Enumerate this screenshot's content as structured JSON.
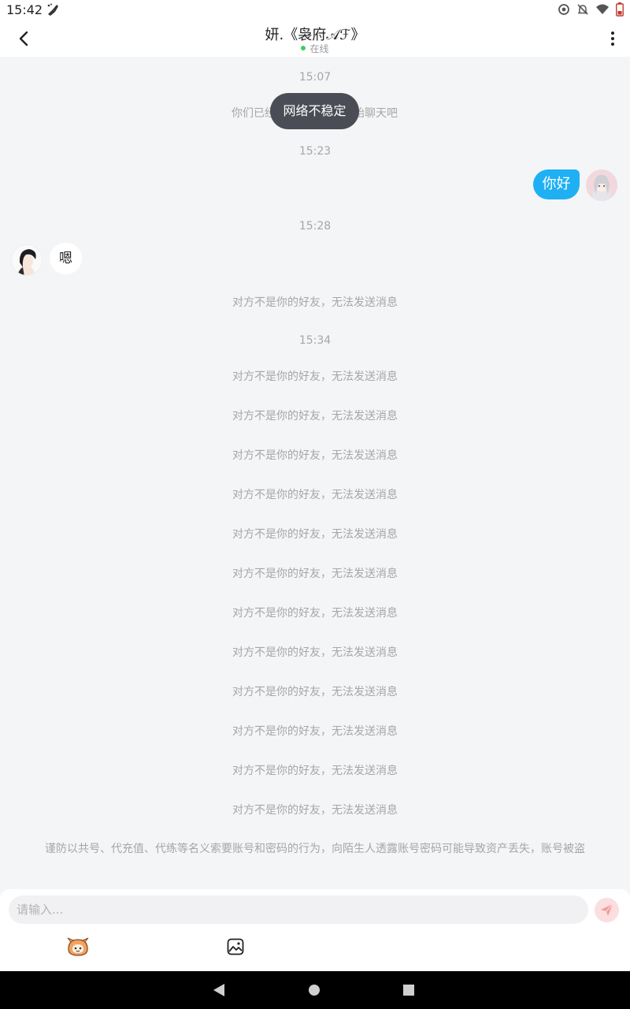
{
  "status_bar": {
    "time": "15:42",
    "icons": [
      "cleaner-icon",
      "location-icon",
      "mute-icon",
      "wifi-icon",
      "battery-icon"
    ]
  },
  "header": {
    "title": "妍.《袅府𝒜ℱ》",
    "status": "在线",
    "back_icon": "chevron-left-icon",
    "more_icon": "more-vertical-icon"
  },
  "toast": "网络不稳定",
  "messages": {
    "time_1507": "15:07",
    "system_friend": "你们已经是好友了，开始聊天吧",
    "system_friend_visible_left": "你们已经",
    "system_friend_visible_right": "始聊天吧",
    "time_1523": "15:23",
    "outgoing_hello": "你好",
    "time_1528": "15:28",
    "incoming_en": "嗯",
    "not_friend_notice": "对方不是你的好友，无法发送消息",
    "time_1534": "15:34",
    "not_friend_list": [
      "对方不是你的好友，无法发送消息",
      "对方不是你的好友，无法发送消息",
      "对方不是你的好友，无法发送消息",
      "对方不是你的好友，无法发送消息",
      "对方不是你的好友，无法发送消息",
      "对方不是你的好友，无法发送消息",
      "对方不是你的好友，无法发送消息",
      "对方不是你的好友，无法发送消息",
      "对方不是你的好友，无法发送消息",
      "对方不是你的好友，无法发送消息",
      "对方不是你的好友，无法发送消息",
      "对方不是你的好友，无法发送消息"
    ],
    "security_warning": "谨防以共号、代充值、代练等名义索要账号和密码的行为，向陌生人透露账号密码可能导致资产丢失，账号被盗"
  },
  "composer": {
    "placeholder": "请输入...",
    "send_icon": "send-icon",
    "tools": [
      "emoji-icon",
      "image-icon"
    ]
  },
  "colors": {
    "accent_blue": "#1fb0f4",
    "online_green": "#3ccf5a",
    "send_bg": "#fbdede",
    "toast_bg": "#4a4d55"
  }
}
